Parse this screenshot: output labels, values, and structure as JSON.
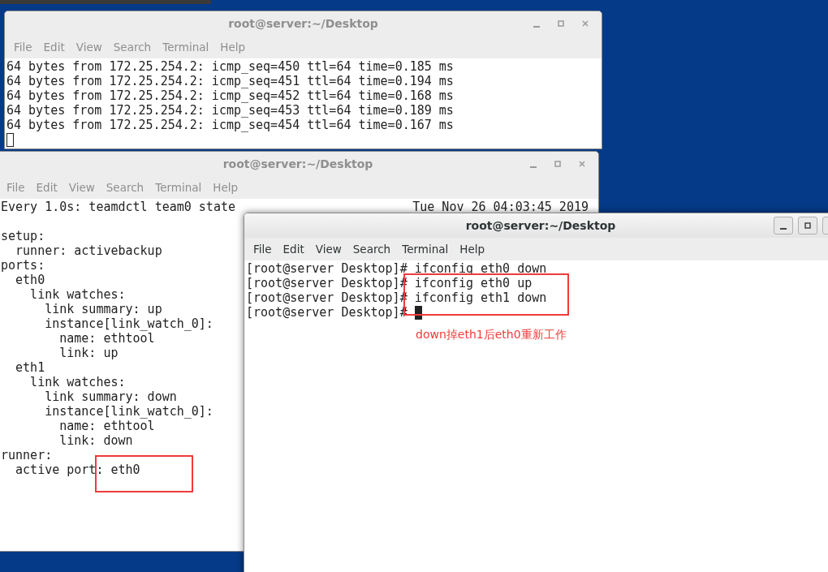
{
  "windows": [
    {
      "title": "root@server:~/Desktop",
      "active": false,
      "menu": [
        "File",
        "Edit",
        "View",
        "Search",
        "Terminal",
        "Help"
      ],
      "lines": [
        "64 bytes from 172.25.254.2: icmp_seq=450 ttl=64 time=0.185 ms",
        "64 bytes from 172.25.254.2: icmp_seq=451 ttl=64 time=0.194 ms",
        "64 bytes from 172.25.254.2: icmp_seq=452 ttl=64 time=0.168 ms",
        "64 bytes from 172.25.254.2: icmp_seq=453 ttl=64 time=0.189 ms",
        "64 bytes from 172.25.254.2: icmp_seq=454 ttl=64 time=0.167 ms"
      ],
      "show_cursor": true
    },
    {
      "title": "root@server:~/Desktop",
      "active": false,
      "menu": [
        "File",
        "Edit",
        "View",
        "Search",
        "Terminal",
        "Help"
      ],
      "header": {
        "command": "Every 1.0s: teamdctl team0 state",
        "time": "Tue Nov 26 04:03:45 2019"
      },
      "lines": [
        "setup:",
        "  runner: activebackup",
        "ports:",
        "  eth0",
        "    link watches:",
        "      link summary: up",
        "      instance[link_watch_0]:",
        "        name: ethtool",
        "        link: up",
        "  eth1",
        "    link watches:",
        "      link summary: down",
        "      instance[link_watch_0]:",
        "        name: ethtool",
        "        link: down",
        "runner:",
        "  active port: eth0"
      ],
      "show_cursor": false,
      "annotations": [
        {
          "kind": "box"
        }
      ]
    },
    {
      "title": "root@server:~/Desktop",
      "active": true,
      "menu": [
        "File",
        "Edit",
        "View",
        "Search",
        "Terminal",
        "Help"
      ],
      "lines": [
        "[root@server Desktop]# ifconfig eth0 down",
        "[root@server Desktop]# ifconfig eth0 up",
        "[root@server Desktop]# ifconfig eth1 down",
        "[root@server Desktop]# "
      ],
      "show_cursor": true,
      "annotations": [
        {
          "kind": "box"
        },
        {
          "kind": "note",
          "text": "down掉eth1后eth0重新工作"
        }
      ]
    }
  ]
}
